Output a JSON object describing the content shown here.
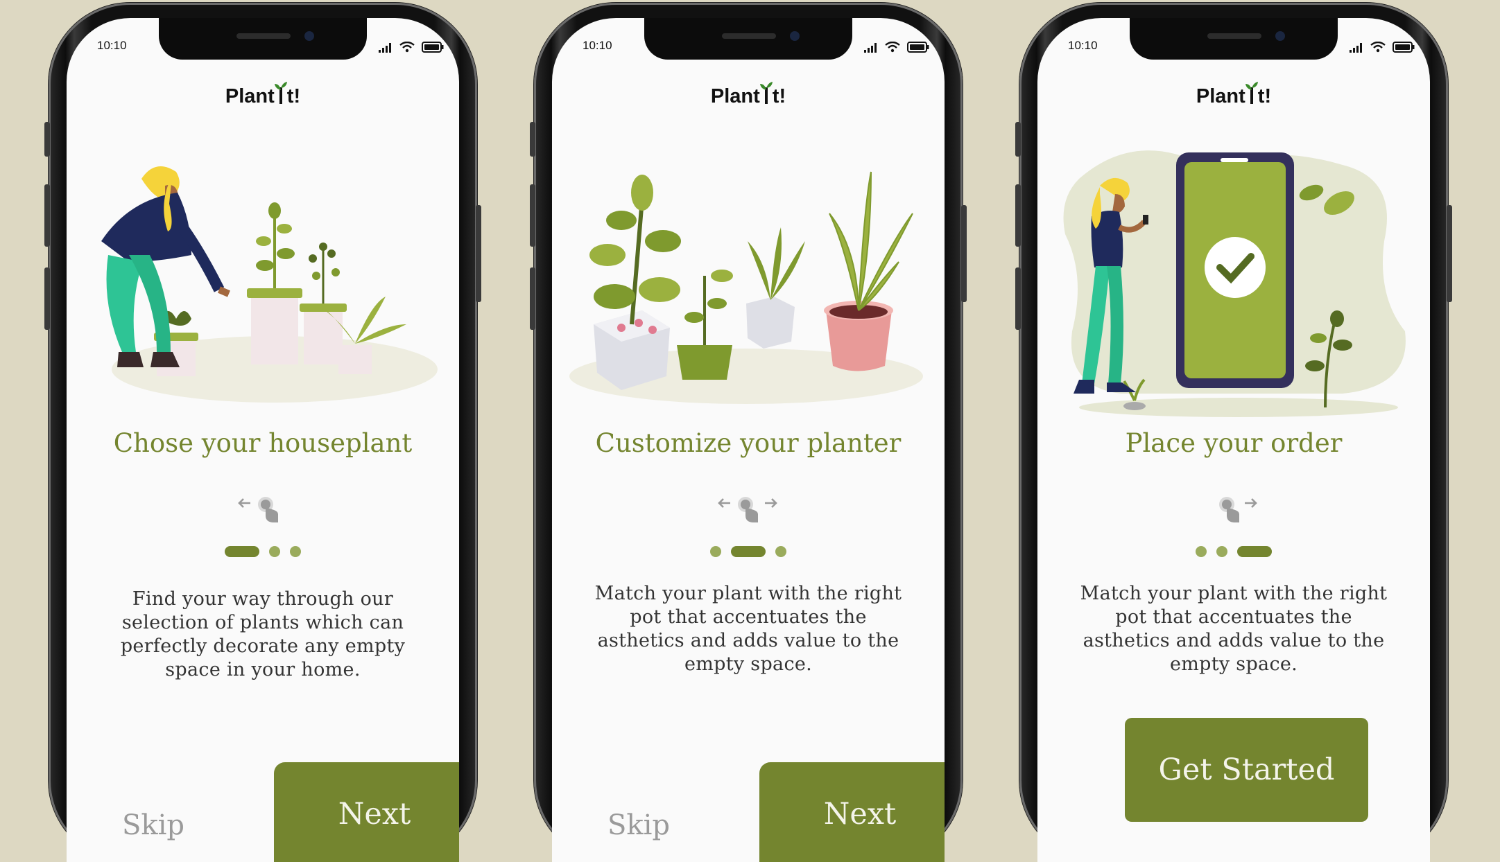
{
  "colors": {
    "background": "#ddd8c2",
    "accent": "#74852f",
    "accent_light": "#9aab5c"
  },
  "app": {
    "logo_prefix": "Plant",
    "logo_suffix": "t!"
  },
  "screens": [
    {
      "time": "10:10",
      "title": "Chose your houseplant",
      "description": "Find your way through our selection of plants which can perfectly decorate any empty space in your home.",
      "active_step": 1,
      "total_steps": 3,
      "swipe_hint": "swipe-left",
      "skip_label": "Skip",
      "next_label": "Next"
    },
    {
      "time": "10:10",
      "title": "Customize your planter",
      "description": "Match your plant with the right pot that accentuates the asthetics and adds value to the empty space.",
      "active_step": 2,
      "total_steps": 3,
      "swipe_hint": "swipe-both",
      "skip_label": "Skip",
      "next_label": "Next"
    },
    {
      "time": "10:10",
      "title": "Place your order",
      "description": "Match your plant with the right pot that accentuates the asthetics and adds value to the empty space.",
      "active_step": 3,
      "total_steps": 3,
      "swipe_hint": "swipe-right",
      "cta_label": "Get Started"
    }
  ]
}
